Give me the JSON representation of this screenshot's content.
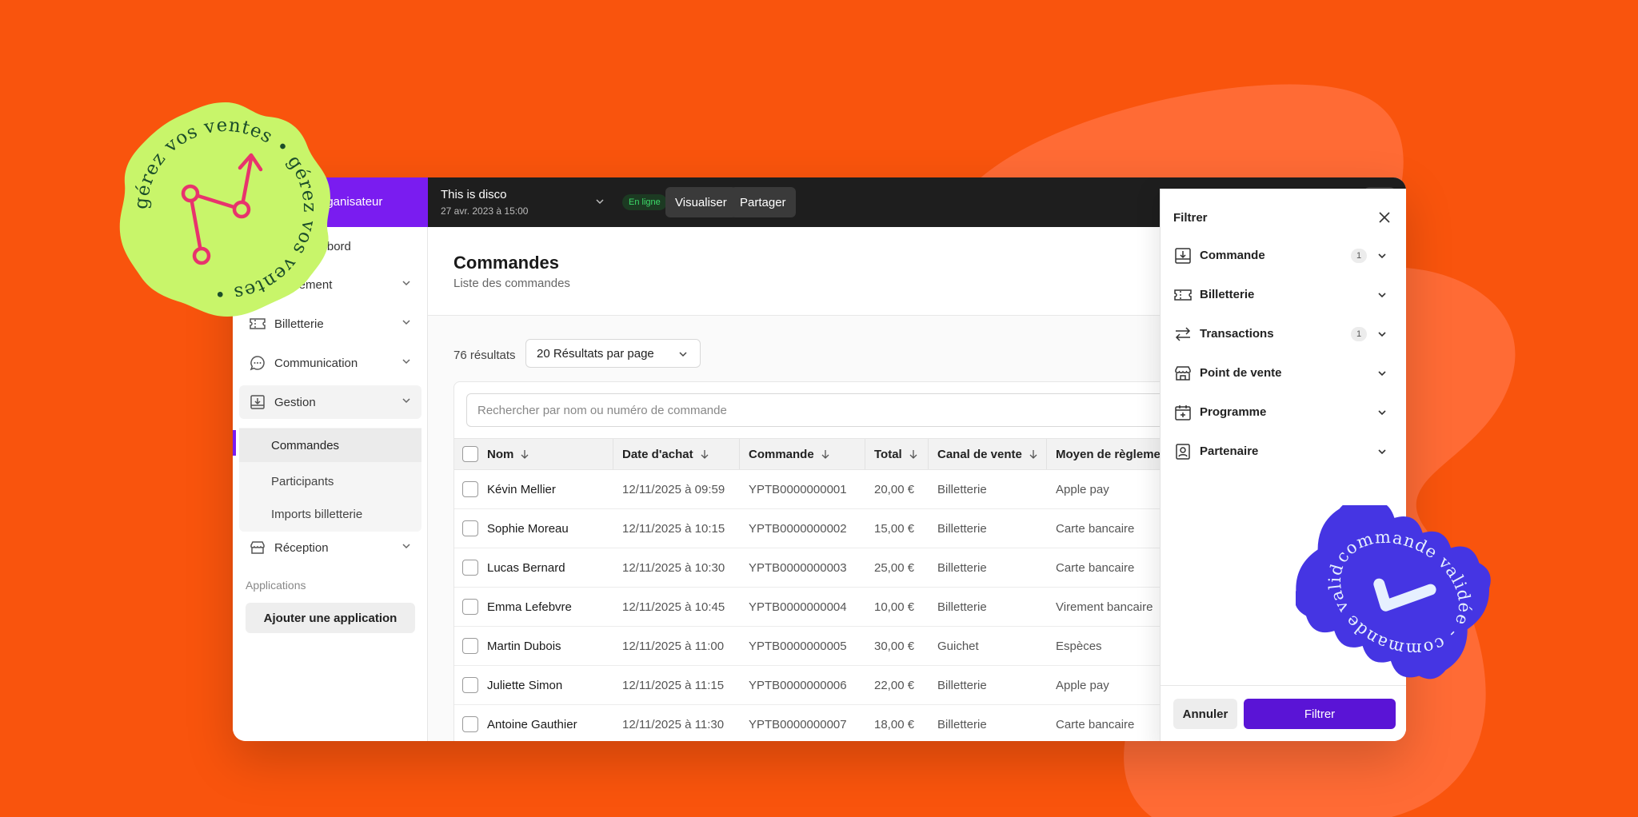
{
  "colors": {
    "background": "#f9540d",
    "blob": "#ff6b35",
    "brand_purple": "#7a1cf0",
    "filter_button": "#5a14d6",
    "sticker_green": "#c8f56a",
    "sticker_pink": "#e8336d",
    "sticker_blue": "#4535e3",
    "online_green": "#3ddc6a"
  },
  "stickers": {
    "left_text": "gérez vos ventes • gérez vos ventes •",
    "right_text": "commande validée - commande validée -"
  },
  "sidebar": {
    "org_label": "organisateur",
    "items": [
      {
        "label": "de bord",
        "icon": "dashboard-icon"
      },
      {
        "label": "énement",
        "icon": "calendar-icon"
      },
      {
        "label": "Billetterie",
        "icon": "ticket-icon"
      },
      {
        "label": "Communication",
        "icon": "chat-icon"
      },
      {
        "label": "Gestion",
        "icon": "inbox-download-icon"
      }
    ],
    "sub_items": [
      "Commandes",
      "Participants",
      "Imports billetterie"
    ],
    "reception_label": "Réception",
    "apps_label": "Applications",
    "add_app_label": "Ajouter une application"
  },
  "topbar": {
    "event_title": "This is disco",
    "event_date": "27 avr. 2023 à 15:00",
    "status": "En ligne",
    "view_label": "Visualiser",
    "share_label": "Partager"
  },
  "main": {
    "title": "Commandes",
    "subtitle": "Liste des commandes",
    "result_count": "76 résultats",
    "per_page": "20 Résultats par page",
    "search_placeholder": "Rechercher par nom ou numéro de commande",
    "columns": [
      "Nom",
      "Date d'achat",
      "Commande",
      "Total",
      "Canal de vente",
      "Moyen de règlement"
    ],
    "rows": [
      {
        "name": "Kévin Mellier",
        "date": "12/11/2025 à 09:59",
        "order": "YPTB0000000001",
        "total": "20,00 €",
        "channel": "Billetterie",
        "payment": "Apple pay"
      },
      {
        "name": "Sophie Moreau",
        "date": "12/11/2025 à 10:15",
        "order": "YPTB0000000002",
        "total": "15,00 €",
        "channel": "Billetterie",
        "payment": "Carte bancaire"
      },
      {
        "name": "Lucas Bernard",
        "date": "12/11/2025 à 10:30",
        "order": "YPTB0000000003",
        "total": "25,00 €",
        "channel": "Billetterie",
        "payment": "Carte bancaire"
      },
      {
        "name": "Emma Lefebvre",
        "date": "12/11/2025 à 10:45",
        "order": "YPTB0000000004",
        "total": "10,00 €",
        "channel": "Billetterie",
        "payment": "Virement bancaire"
      },
      {
        "name": "Martin Dubois",
        "date": "12/11/2025 à 11:00",
        "order": "YPTB0000000005",
        "total": "30,00 €",
        "channel": "Guichet",
        "payment": "Espèces"
      },
      {
        "name": "Juliette Simon",
        "date": "12/11/2025 à 11:15",
        "order": "YPTB0000000006",
        "total": "22,00 €",
        "channel": "Billetterie",
        "payment": "Apple pay"
      },
      {
        "name": "Antoine Gauthier",
        "date": "12/11/2025 à 11:30",
        "order": "YPTB0000000007",
        "total": "18,00 €",
        "channel": "Billetterie",
        "payment": "Carte bancaire"
      }
    ]
  },
  "filter": {
    "title": "Filtrer",
    "items": [
      {
        "label": "Commande",
        "icon": "download-box-icon",
        "count": "1"
      },
      {
        "label": "Billetterie",
        "icon": "ticket-icon",
        "count": ""
      },
      {
        "label": "Transactions",
        "icon": "transfer-arrows-icon",
        "count": "1"
      },
      {
        "label": "Point de vente",
        "icon": "store-icon",
        "count": ""
      },
      {
        "label": "Programme",
        "icon": "calendar-plus-icon",
        "count": ""
      },
      {
        "label": "Partenaire",
        "icon": "badge-person-icon",
        "count": ""
      }
    ],
    "cancel_label": "Annuler",
    "apply_label": "Filtrer"
  }
}
